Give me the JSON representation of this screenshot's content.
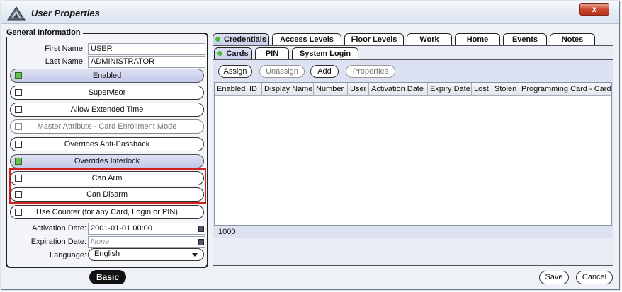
{
  "window": {
    "title": "User Properties",
    "close_label": "x"
  },
  "general": {
    "title": "General Information",
    "first_name_label": "First Name:",
    "first_name": "USER",
    "last_name_label": "Last Name:",
    "last_name": "ADMINISTRATOR",
    "toggles": [
      {
        "label": "Enabled",
        "checked": true
      },
      {
        "label": "Supervisor",
        "checked": false
      },
      {
        "label": "Allow Extended Time",
        "checked": false
      },
      {
        "label": "Master Attribute - Card Enrollment Mode",
        "checked": false
      },
      {
        "label": "Overrides Anti-Passback",
        "checked": false
      },
      {
        "label": "Overrides Interlock",
        "checked": true
      },
      {
        "label": "Can Arm",
        "checked": false
      },
      {
        "label": "Can Disarm",
        "checked": false
      },
      {
        "label": "Use Counter (for any Card, Login or PIN)",
        "checked": false
      }
    ],
    "activation_label": "Activation Date:",
    "activation_value": "2001-01-01 00:00",
    "expiration_label": "Expiration Date:",
    "expiration_value": "None",
    "language_label": "Language:",
    "language_value": "English",
    "basic_button": "Basic"
  },
  "tabs": [
    "Credentials",
    "Access Levels",
    "Floor Levels",
    "Work",
    "Home",
    "Events",
    "Notes"
  ],
  "subtabs": [
    "Cards",
    "PIN",
    "System Login"
  ],
  "card_buttons": [
    "Assign",
    "Unassign",
    "Add",
    "Properties"
  ],
  "grid_columns": [
    "Enabled",
    "ID",
    "Display Name",
    "Number",
    "User",
    "Activation Date",
    "Expiry Date",
    "Lost",
    "Stolen",
    "Programming Card - Card Er"
  ],
  "record_count": "1000",
  "footer": {
    "save": "Save",
    "cancel": "Cancel"
  }
}
